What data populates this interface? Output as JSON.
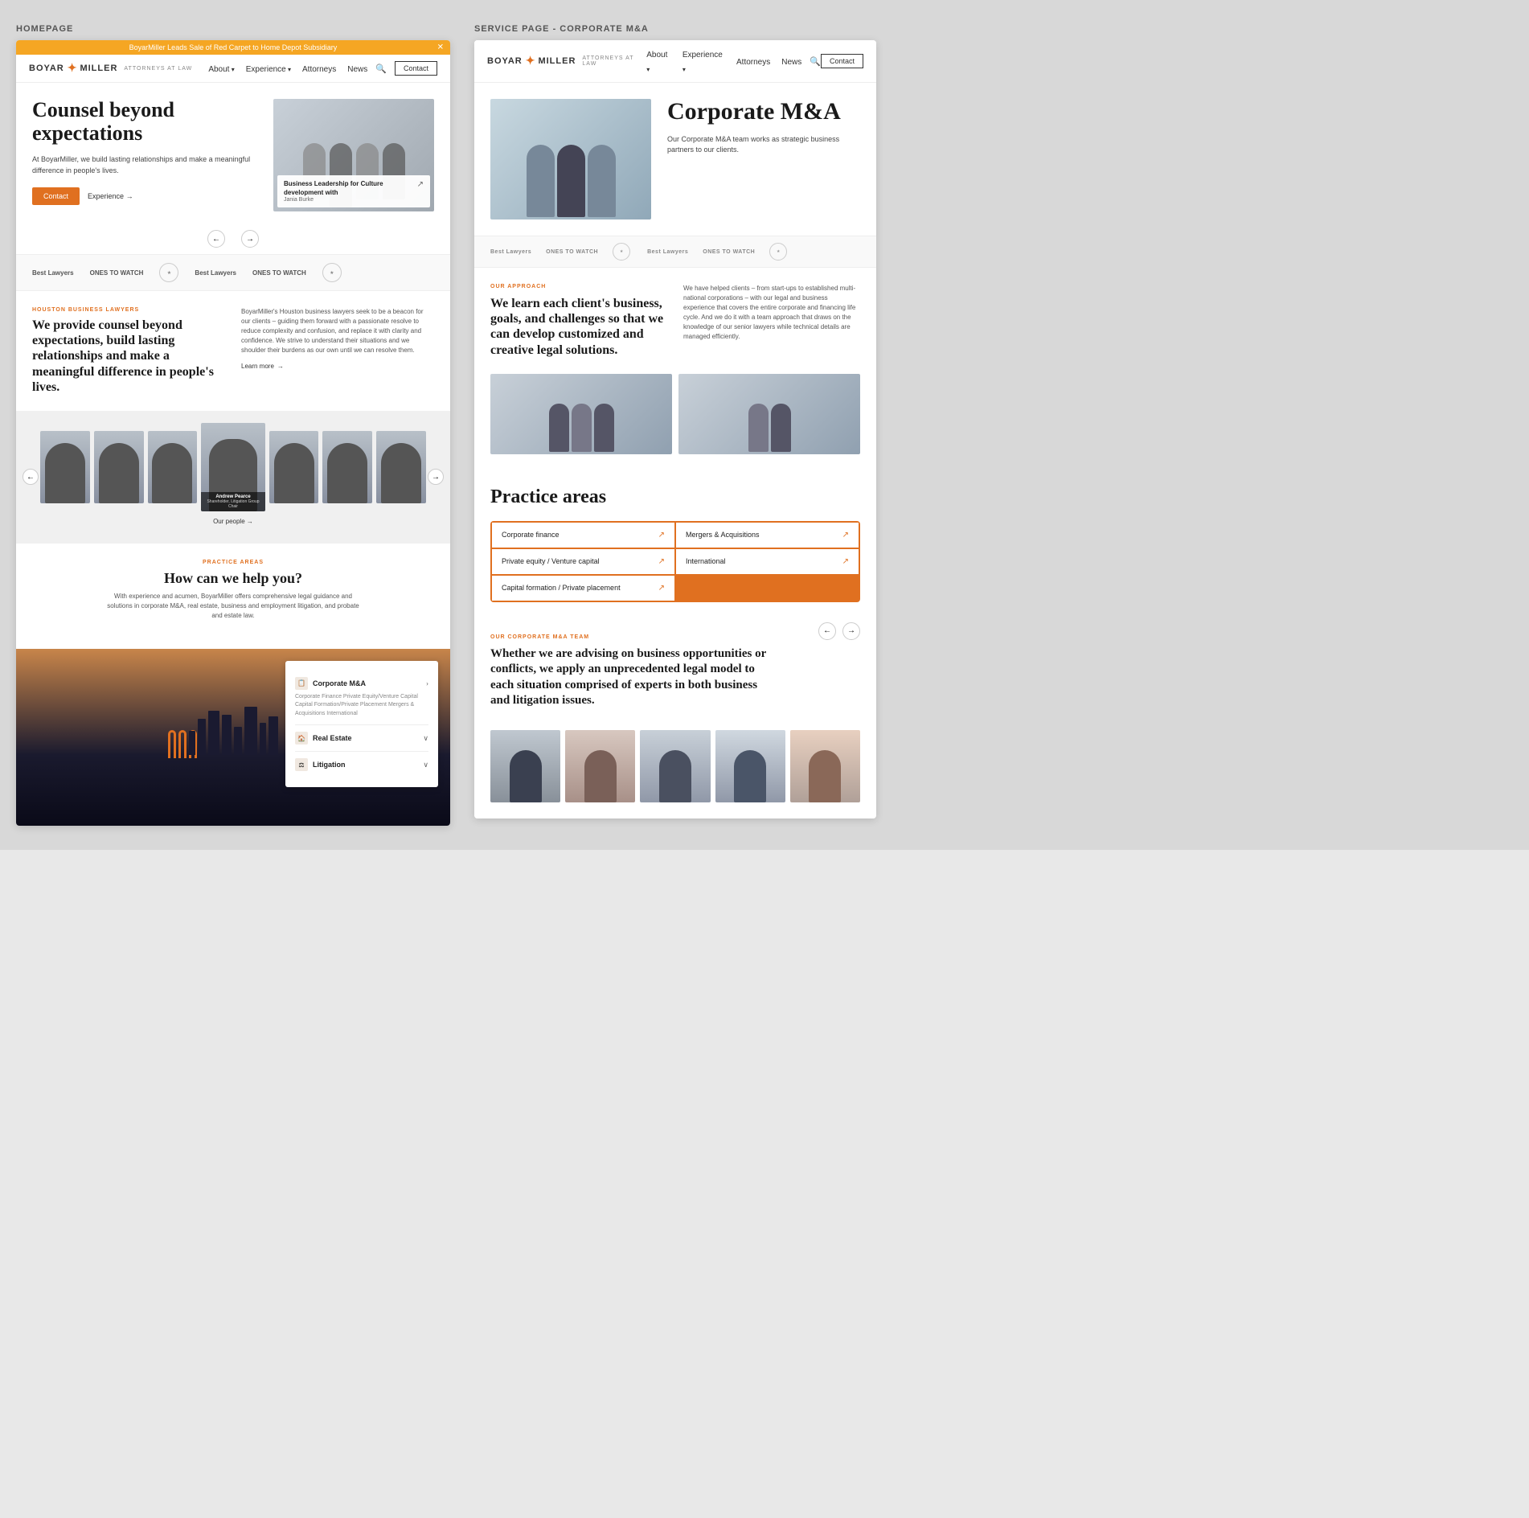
{
  "labels": {
    "homepage": "HOMEPAGE",
    "service_page": "SERVICE PAGE - CORPORATE M&A"
  },
  "homepage": {
    "notif_bar": "BoyarMiller Leads Sale of Red Carpet to Home Depot Subsidiary",
    "logo_part1": "BOYAR",
    "logo_part2": "MILLER",
    "logo_sub": "ATTORNEYS AT LAW",
    "nav": {
      "about": "About",
      "experience": "Experience",
      "attorneys": "Attorneys",
      "news": "News",
      "contact": "Contact"
    },
    "hero": {
      "title": "Counsel beyond expectations",
      "subtitle": "At BoyarMiller, we build lasting relationships and make a meaningful difference in people's lives.",
      "btn_contact": "Contact",
      "btn_experience": "Experience",
      "caption_title": "Business Leadership for Culture development with",
      "caption_author": "Jania Burke",
      "caption_arrow": "↗"
    },
    "arrows": {
      "prev": "←",
      "next": "→"
    },
    "awards": [
      {
        "name": "Best Lawyers",
        "type": "text"
      },
      {
        "name": "ONES TO WATCH",
        "type": "text"
      },
      {
        "name": "badge1",
        "type": "badge"
      },
      {
        "name": "Best Lawyers",
        "type": "text"
      },
      {
        "name": "ONES TO WATCH",
        "type": "text"
      },
      {
        "name": "badge2",
        "type": "badge"
      }
    ],
    "houston": {
      "tag": "Houston Business Lawyers",
      "title": "We provide counsel beyond expectations, build lasting relationships and make a meaningful difference in people's lives.",
      "body": "BoyarMiller's Houston business lawyers seek to be a beacon for our clients – guiding them forward with a passionate resolve to reduce complexity and confusion, and replace it with clarity and confidence. We strive to understand their situations and we shoulder their burdens as our own until we can resolve them.",
      "learn_more": "Learn more"
    },
    "people": {
      "featured_name": "Andrew Pearce",
      "featured_role": "Shareholder, Litigation Group Chair",
      "our_people": "Our people"
    },
    "practice": {
      "tag": "Practice areas",
      "title": "How can we help you?",
      "subtitle": "With experience and acumen, BoyarMiller offers comprehensive legal guidance and solutions in corporate M&A, real estate, business and employment litigation, and probate and estate law.",
      "items": [
        {
          "icon": "📋",
          "name": "Corporate M&A",
          "arrow": "›",
          "sub": "Corporate Finance   Private Equity/Venture Capital\nCapital Formation/Private Placement   Mergers & Acquisitions\nInternational",
          "expanded": true
        },
        {
          "icon": "🏠",
          "name": "Real Estate",
          "arrow": "∨",
          "expanded": false
        },
        {
          "icon": "⚖",
          "name": "Litigation",
          "arrow": "∨",
          "expanded": false
        }
      ]
    }
  },
  "service_page": {
    "logo_part1": "BOYAR",
    "logo_part2": "MILLER",
    "logo_sub": "ATTORNEYS AT LAW",
    "nav": {
      "about": "About",
      "experience": "Experience",
      "attorneys": "Attorneys",
      "news": "News",
      "contact": "Contact"
    },
    "hero": {
      "title": "Corporate M&A",
      "desc": "Our Corporate M&A team works as strategic business partners to our clients."
    },
    "awards": [
      {
        "label": "Best Lawyers",
        "type": "text"
      },
      {
        "label": "ONES TO WATCH",
        "type": "text"
      },
      {
        "label": "badge",
        "type": "badge"
      },
      {
        "label": "Best Lawyers",
        "type": "text"
      },
      {
        "label": "ONES TO WATCH",
        "type": "text"
      },
      {
        "label": "badge2",
        "type": "badge"
      }
    ],
    "approach": {
      "tag": "Our approach",
      "title": "We learn each client's business, goals, and challenges so that we can develop customized and creative legal solutions.",
      "body": "We have helped clients – from start-ups to established multi-national corporations – with our legal and business experience that covers the entire corporate and financing life cycle. And we do it with a team approach that draws on the knowledge of our senior lawyers while technical details are managed efficiently."
    },
    "practice_areas": {
      "title": "Practice areas",
      "items": [
        {
          "label": "Corporate finance",
          "arrow": "↗"
        },
        {
          "label": "Mergers & Acquisitions",
          "arrow": "↗"
        },
        {
          "label": "Private equity / Venture capital",
          "arrow": "↗"
        },
        {
          "label": "International",
          "arrow": "↗"
        },
        {
          "label": "Capital formation / Private placement",
          "arrow": "↗"
        }
      ]
    },
    "team": {
      "tag": "Our Corporate M&A team",
      "title": "Whether we are advising on business opportunities or conflicts, we apply an unprecedented legal model to each situation comprised of experts in both business and litigation issues.",
      "prev": "←",
      "next": "→"
    }
  }
}
